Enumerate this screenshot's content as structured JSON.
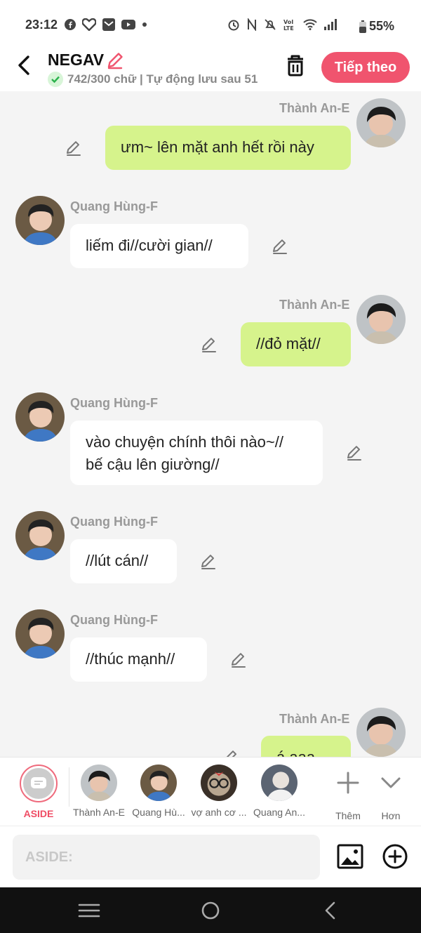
{
  "status": {
    "time": "23:12",
    "battery": "55%"
  },
  "header": {
    "title": "NEGAV",
    "subtitle": "742/300 chữ | Tự động lưu sau 51",
    "next_label": "Tiếp theo"
  },
  "messages": [
    {
      "speaker": "Thành An-E",
      "side": "me",
      "text": "ưm~ lên mặt anh hết rồi này"
    },
    {
      "speaker": "Quang Hùng-F",
      "side": "other",
      "text": "liếm đi//cười gian//"
    },
    {
      "speaker": "Thành An-E",
      "side": "me",
      "text": "//đỏ mặt//"
    },
    {
      "speaker": "Quang Hùng-F",
      "side": "other",
      "text": "vào chuyện chính thôi nào~//\nbế cậu lên giường//"
    },
    {
      "speaker": "Quang Hùng-F",
      "side": "other",
      "text": "//lút cán//"
    },
    {
      "speaker": "Quang Hùng-F",
      "side": "other",
      "text": "//thúc mạnh//"
    },
    {
      "speaker": "Thành An-E",
      "side": "me",
      "text": "á aaa"
    }
  ],
  "characters": {
    "aside_label": "ASIDE",
    "items": [
      "Thành An-E",
      "Quang Hù...",
      "vợ anh cơ ...",
      "Quang An..."
    ],
    "more_label": "Thêm",
    "expand_label": "Hơn"
  },
  "input": {
    "placeholder": "ASIDE:"
  },
  "colors": {
    "accent": "#f0546e",
    "my_bubble": "#d6f38c",
    "other_bubble": "#ffffff"
  }
}
